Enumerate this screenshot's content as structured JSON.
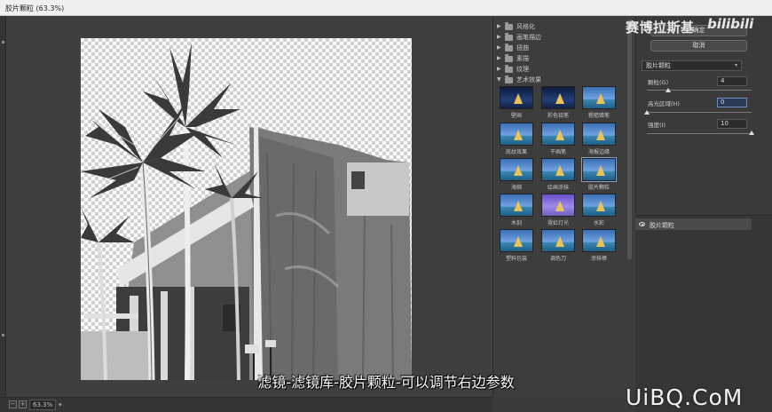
{
  "window": {
    "title": "胶片颗粒 (63.3%)"
  },
  "preview": {
    "zoom": "63.3%"
  },
  "gallery": {
    "folders": [
      {
        "label": "风格化",
        "expanded": false
      },
      {
        "label": "画笔描边",
        "expanded": false
      },
      {
        "label": "扭曲",
        "expanded": false
      },
      {
        "label": "素描",
        "expanded": false
      },
      {
        "label": "纹理",
        "expanded": false
      },
      {
        "label": "艺术效果",
        "expanded": true
      }
    ],
    "filters": [
      {
        "label": "壁画"
      },
      {
        "label": "彩色铅笔"
      },
      {
        "label": "粗糙蜡笔"
      },
      {
        "label": "底纹效果"
      },
      {
        "label": "干画笔"
      },
      {
        "label": "海报边缘"
      },
      {
        "label": "海绵"
      },
      {
        "label": "绘画涂抹"
      },
      {
        "label": "胶片颗粒",
        "selected": true
      },
      {
        "label": "木刻"
      },
      {
        "label": "霓虹灯光"
      },
      {
        "label": "水彩"
      },
      {
        "label": "塑料包装"
      },
      {
        "label": "调色刀"
      },
      {
        "label": "涂抹棒"
      }
    ]
  },
  "settings": {
    "ok_label": "确定",
    "cancel_label": "取消",
    "filter_select": "胶片颗粒",
    "params": [
      {
        "label": "颗粒(G)",
        "value": "4",
        "fraction": 0.2
      },
      {
        "label": "高光区域(H)",
        "value": "0",
        "fraction": 0.0
      },
      {
        "label": "强度(I)",
        "value": "10",
        "fraction": 1.0
      }
    ]
  },
  "layers": {
    "items": [
      {
        "label": "胶片颗粒"
      }
    ]
  },
  "overlay": {
    "caption": "滤镜-滤镜库-胶片颗粒-可以调节右边参数",
    "watermark_author": "赛博拉斯基",
    "watermark_brand": "bilibili",
    "watermark_site": "UiBQ.CoM"
  }
}
